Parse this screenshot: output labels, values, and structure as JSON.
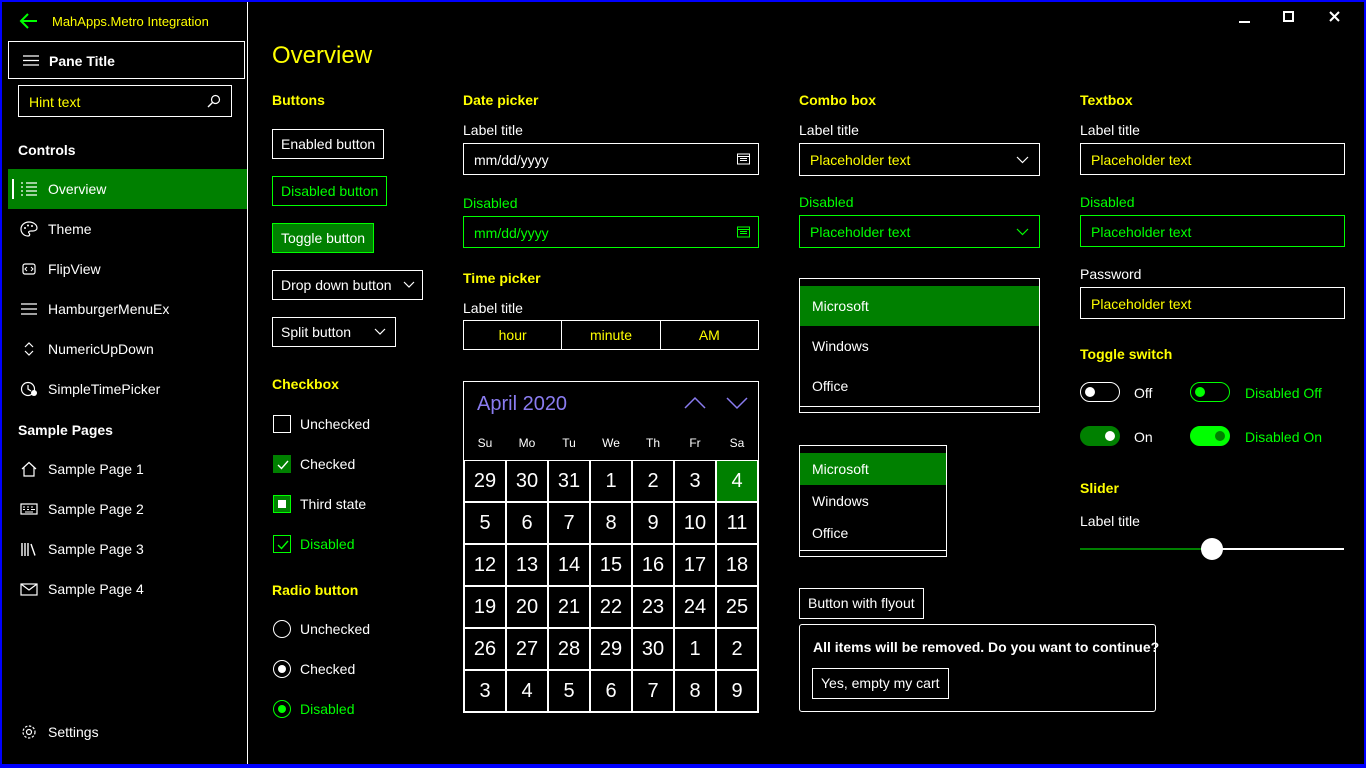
{
  "window": {
    "title": "MahApps.Metro Integration",
    "min": "minimize-icon",
    "max": "maximize-icon",
    "close": "close-icon",
    "border_color": "#0000ff"
  },
  "sidebar": {
    "pane_title": "Pane Title",
    "search_placeholder": "Hint text",
    "groups": {
      "controls": "Controls",
      "sample_pages": "Sample Pages"
    },
    "items": [
      {
        "label": "Overview",
        "icon": "list-icon",
        "selected": true
      },
      {
        "label": "Theme",
        "icon": "palette-icon"
      },
      {
        "label": "FlipView",
        "icon": "flipview-icon"
      },
      {
        "label": "HamburgerMenuEx",
        "icon": "hamburger-icon"
      },
      {
        "label": "NumericUpDown",
        "icon": "updown-icon"
      },
      {
        "label": "SimpleTimePicker",
        "icon": "time-icon"
      }
    ],
    "pages": [
      {
        "label": "Sample Page 1",
        "icon": "home-icon"
      },
      {
        "label": "Sample Page 2",
        "icon": "keyboard-icon"
      },
      {
        "label": "Sample Page 3",
        "icon": "library-icon"
      },
      {
        "label": "Sample Page 4",
        "icon": "mail-icon"
      }
    ],
    "settings": "Settings"
  },
  "main": {
    "title": "Overview",
    "buttons": {
      "header": "Buttons",
      "enabled": "Enabled button",
      "disabled": "Disabled button",
      "toggle": "Toggle button",
      "dropdown": "Drop down button",
      "split": "Split button"
    },
    "checkbox": {
      "header": "Checkbox",
      "unchecked": "Unchecked",
      "checked": "Checked",
      "third": "Third state",
      "disabled": "Disabled"
    },
    "radio": {
      "header": "Radio button",
      "unchecked": "Unchecked",
      "checked": "Checked",
      "disabled": "Disabled"
    },
    "date_picker": {
      "header": "Date picker",
      "label": "Label title",
      "value": "mm/dd/yyyy",
      "disabled_label": "Disabled",
      "disabled_value": "mm/dd/yyyy"
    },
    "time_picker": {
      "header": "Time picker",
      "label": "Label title",
      "hour": "hour",
      "minute": "minute",
      "ampm": "AM"
    },
    "calendar": {
      "month": "April 2020",
      "days_of_week": [
        "Su",
        "Mo",
        "Tu",
        "We",
        "Th",
        "Fr",
        "Sa"
      ],
      "days": [
        "29",
        "30",
        "31",
        "1",
        "2",
        "3",
        "4",
        "5",
        "6",
        "7",
        "8",
        "9",
        "10",
        "11",
        "12",
        "13",
        "14",
        "15",
        "16",
        "17",
        "18",
        "19",
        "20",
        "21",
        "22",
        "23",
        "24",
        "25",
        "26",
        "27",
        "28",
        "29",
        "30",
        "1",
        "2",
        "3",
        "4",
        "5",
        "6",
        "7",
        "8",
        "9"
      ],
      "selected_index": 6
    },
    "combo_box": {
      "header": "Combo box",
      "label": "Label title",
      "placeholder": "Placeholder text",
      "disabled_label": "Disabled",
      "disabled_placeholder": "Placeholder text"
    },
    "list1": [
      "Microsoft",
      "Windows",
      "Office"
    ],
    "list2": [
      "Microsoft",
      "Windows",
      "Office"
    ],
    "flyout": {
      "button": "Button with flyout",
      "message": "All items will be removed. Do you want to continue?",
      "confirm": "Yes, empty my cart"
    },
    "textbox": {
      "header": "Textbox",
      "label": "Label title",
      "placeholder": "Placeholder text",
      "disabled_label": "Disabled",
      "disabled_placeholder": "Placeholder text",
      "password_label": "Password",
      "password_placeholder": "Placeholder text"
    },
    "toggle": {
      "header": "Toggle switch",
      "off": "Off",
      "on": "On",
      "disabled_off": "Disabled Off",
      "disabled_on": "Disabled On"
    },
    "slider": {
      "header": "Slider",
      "label": "Label title",
      "value": 0.5
    },
    "colors": {
      "accent": "#008000",
      "highlight": "#00ff00",
      "text_accent": "#ffff00",
      "calendar_header": "#8a7cf0"
    }
  }
}
